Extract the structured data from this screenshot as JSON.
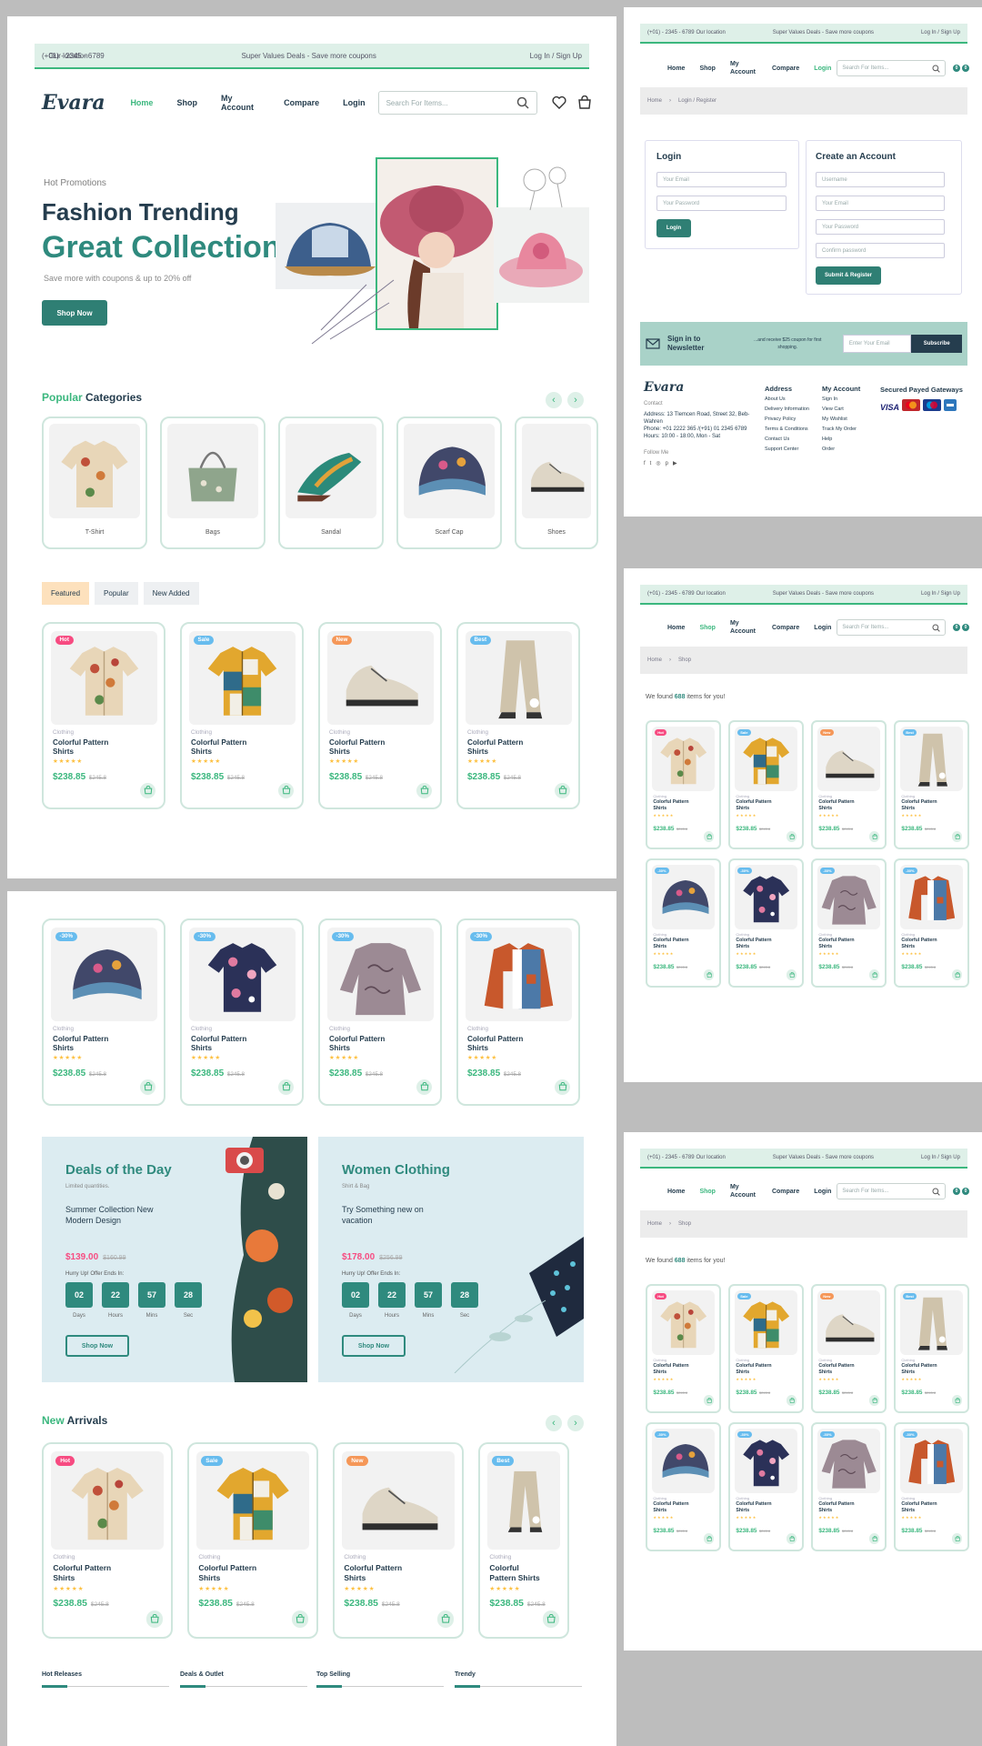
{
  "topbar": {
    "phone": "(+01) - 2345 - 6789",
    "location": "Our location",
    "promo": "Super Values Deals - Save more coupons",
    "auth": "Log In / Sign Up"
  },
  "nav": {
    "logo": "Evara",
    "home": "Home",
    "shop": "Shop",
    "my_account": "My Account",
    "compare": "Compare",
    "login": "Login",
    "search_placeholder": "Search For Items...",
    "badge_count": "0"
  },
  "hero": {
    "kicker": "Hot Promotions",
    "title1": "Fashion Trending",
    "title2": "Great Collection",
    "sub": "Save more with coupons & up to 20% off",
    "cta": "Shop Now"
  },
  "categories": {
    "title_colored": "Popular",
    "title_rest": "Categories",
    "items": [
      "T-Shirt",
      "Bags",
      "Sandal",
      "Scarf Cap",
      "Shoes"
    ]
  },
  "tabs": [
    "Featured",
    "Popular",
    "New Added"
  ],
  "product": {
    "category": "Clothing",
    "name": "Colorful Pattern Shirts",
    "price": "$238.85",
    "old_price": "$245.8",
    "stars": "★★★★★"
  },
  "badges": [
    "Hot",
    "Sale",
    "New",
    "Best",
    "-30%"
  ],
  "deals": [
    {
      "title": "Deals of the Day",
      "sub": "Limited quantities.",
      "desc": "Summer Collection New Modern Design",
      "price": "$139.00",
      "old": "$160.99",
      "hurry": "Hurry Up! Offer Ends In:",
      "counts": [
        "02",
        "22",
        "57",
        "28"
      ],
      "cta": "Shop Now"
    },
    {
      "title": "Women Clothing",
      "sub": "Shirt & Bag",
      "desc": "Try Something new on vacation",
      "price": "$178.00",
      "old": "$256.99",
      "hurry": "Hurry Up! Offer Ends In:",
      "counts": [
        "02",
        "22",
        "57",
        "28"
      ],
      "cta": "Shop Now"
    }
  ],
  "count_units": [
    "Days",
    "Hours",
    "Mins",
    "Sec"
  ],
  "new_arrivals": {
    "colored": "New",
    "rest": "Arrivals"
  },
  "bottom_tabs": [
    "Hot Releases",
    "Deals & Outlet",
    "Top Selling",
    "Trendy"
  ],
  "login_page": {
    "breadcrumb": [
      "Home",
      "Login / Register"
    ],
    "login": {
      "title": "Login",
      "email": "Your Email",
      "password": "Your Password",
      "button": "Login"
    },
    "register": {
      "title": "Create an Account",
      "username": "Username",
      "email": "Your Email",
      "password": "Your Password",
      "confirm": "Confirm password",
      "button": "Submit & Register"
    },
    "newsletter": {
      "title": "Sign in to Newsletter",
      "text": "...and receive $25 coupon for first shopping.",
      "placeholder": "Enter Your Email",
      "button": "Subscribe"
    },
    "footer": {
      "contact_label": "Contact",
      "address": "Address: 13 Tlemcen Road, Street 32, Beb-Wahren",
      "phone": "Phone: +01 2222 365 /(+91) 01 2345 6789",
      "hours": "Hours: 10:00 - 18:00, Mon - Sat",
      "follow": "Follow Me",
      "address_title": "Address",
      "address_links": [
        "About Us",
        "Delivery Information",
        "Privacy Policy",
        "Terms & Conditions",
        "Contact Us",
        "Support Center"
      ],
      "account_title": "My Account",
      "account_links": [
        "Sign In",
        "View Cart",
        "My Wishlist",
        "Track My Order",
        "Help",
        "Order"
      ],
      "pay_title": "Secured Payed Gateways",
      "pay": [
        "VISA"
      ]
    }
  },
  "shop_page": {
    "breadcrumb": [
      "Home",
      "Shop"
    ],
    "found_pre": "We found ",
    "found_num": "688",
    "found_post": " items for you!"
  },
  "colors": {
    "brand": "#3bb77e",
    "dark": "#253d4e",
    "teal": "#2f7f74",
    "tint": "#def0e8"
  }
}
